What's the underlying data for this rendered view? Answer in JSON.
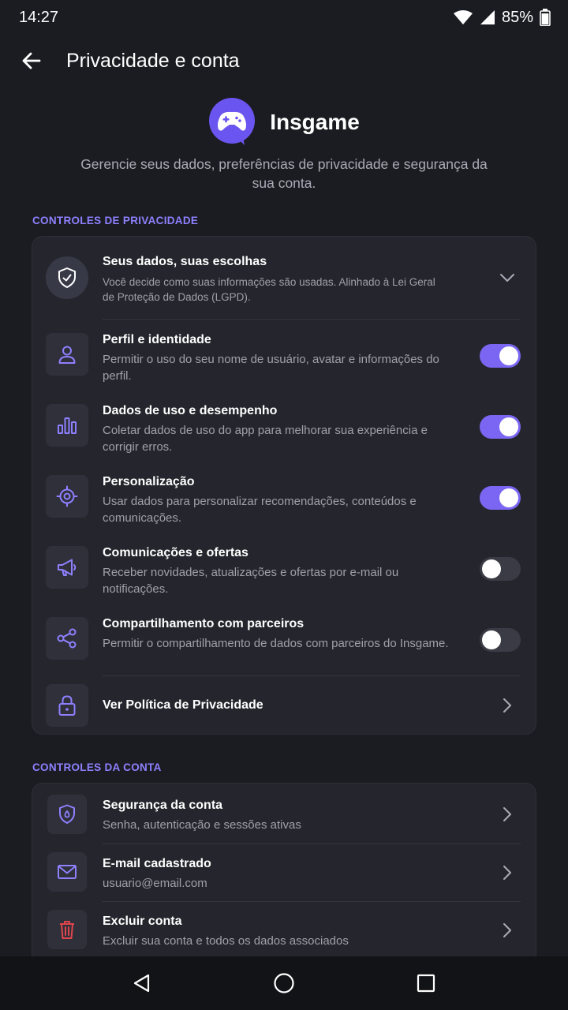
{
  "status": {
    "time": "14:27",
    "battery": "85%"
  },
  "header": {
    "title": "Privacidade e conta"
  },
  "brand": {
    "name": "Insgame",
    "intro": "Gerencie seus dados, preferências de privacidade e segurança da sua conta."
  },
  "privacy": {
    "section_label": "CONTROLES DE PRIVACIDADE",
    "summary": {
      "title": "Seus dados, suas escolhas",
      "desc": "Você decide como suas informações são usadas. Alinhado à Lei Geral de Proteção de Dados (LGPD)."
    },
    "items": [
      {
        "title": "Perfil e identidade",
        "desc": "Permitir o uso do seu nome de usuário, avatar e informações do perfil.",
        "enabled": true,
        "icon": "user-icon"
      },
      {
        "title": "Dados de uso e desempenho",
        "desc": "Coletar dados de uso do app para melhorar sua experiência e corrigir erros.",
        "enabled": true,
        "icon": "bar-chart-icon"
      },
      {
        "title": "Personalização",
        "desc": "Usar dados para personalizar recomendações, conteúdos e comunicações.",
        "enabled": true,
        "icon": "target-icon"
      },
      {
        "title": "Comunicações e ofertas",
        "desc": "Receber novidades, atualizações e ofertas por e-mail ou notificações.",
        "enabled": false,
        "icon": "megaphone-icon"
      },
      {
        "title": "Compartilhamento com parceiros",
        "desc": "Permitir o compartilhamento de dados com parceiros do Insgame.",
        "enabled": false,
        "icon": "share-icon"
      }
    ],
    "policy_link": "Ver Política de Privacidade"
  },
  "account": {
    "section_label": "CONTROLES DA CONTA",
    "items": [
      {
        "title": "Segurança da conta",
        "desc": "Senha, autenticação e sessões ativas",
        "icon": "shield-lock-icon"
      },
      {
        "title": "E-mail cadastrado",
        "desc": "usuario@email.com",
        "icon": "mail-icon"
      },
      {
        "title": "Excluir conta",
        "desc": "Excluir sua conta e todos os dados associados",
        "icon": "trash-icon"
      }
    ]
  },
  "colors": {
    "accent": "#7a66f2",
    "danger": "#e0454c",
    "background": "#1b1c21",
    "card": "#25262d"
  }
}
